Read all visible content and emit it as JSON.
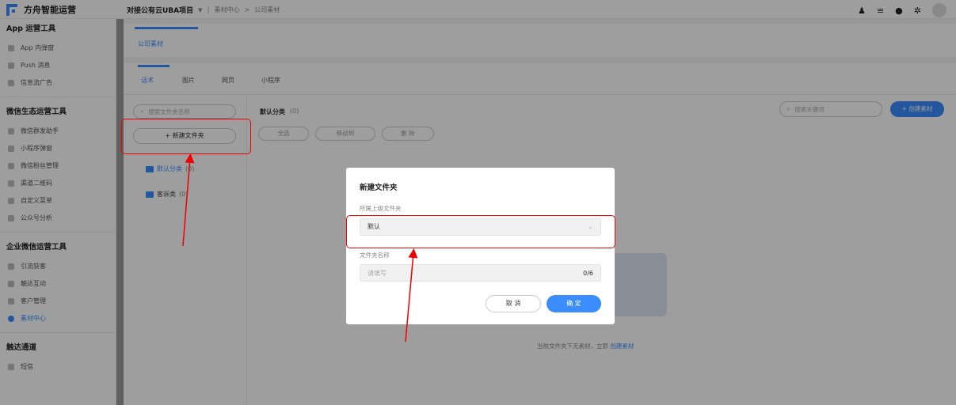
{
  "app": {
    "name": "方舟智能运营"
  },
  "header": {
    "project": "对接公有云UBA项目",
    "breadcrumb_root": "素材中心",
    "breadcrumb_sep": ">",
    "breadcrumb_leaf": "公司素材",
    "divider": "|"
  },
  "sidebar": {
    "groups": [
      {
        "title": "App 运营工具",
        "items": [
          "App 内弹窗",
          "Push 消息",
          "信息流广告"
        ]
      },
      {
        "title": "微信生态运营工具",
        "items": [
          "微信群发助手",
          "小程序弹窗",
          "微信粉丝管理",
          "渠道二维码",
          "自定义菜单",
          "公众号分析"
        ]
      },
      {
        "title": "企业微信运营工具",
        "items": [
          "引流获客",
          "触达互动",
          "客户管理",
          "素材中心"
        ]
      },
      {
        "title": "触达通道",
        "items": [
          "短信"
        ]
      }
    ]
  },
  "tabs_primary": {
    "active": "公司素材"
  },
  "tabs_secondary": [
    "话术",
    "图片",
    "网页",
    "小程序"
  ],
  "folders": {
    "search_placeholder": "搜索文件夹名称",
    "new_folder_label": "+ 新建文件夹",
    "items": [
      {
        "name": "默认分类",
        "count": "(0)"
      },
      {
        "name": "客诉类",
        "count": "(0)"
      }
    ]
  },
  "content": {
    "category_name": "默认分类",
    "category_count": "(0)",
    "select_all": "全选",
    "move_to": "移动到",
    "delete": "删 除",
    "keyword_placeholder": "搜索关键词",
    "create_button": "+ 创建素材",
    "empty_text": "当前文件夹下无素材，立即",
    "empty_link": "创建素材"
  },
  "modal": {
    "title": "新建文件夹",
    "parent_label": "所属上级文件夹",
    "parent_value": "默认",
    "name_label": "文件夹名称",
    "name_placeholder": "请填写",
    "name_counter": "0/6",
    "cancel": "取 消",
    "confirm": "确 定"
  },
  "colors": {
    "accent": "#3b8cff",
    "annotation": "#e00000"
  }
}
